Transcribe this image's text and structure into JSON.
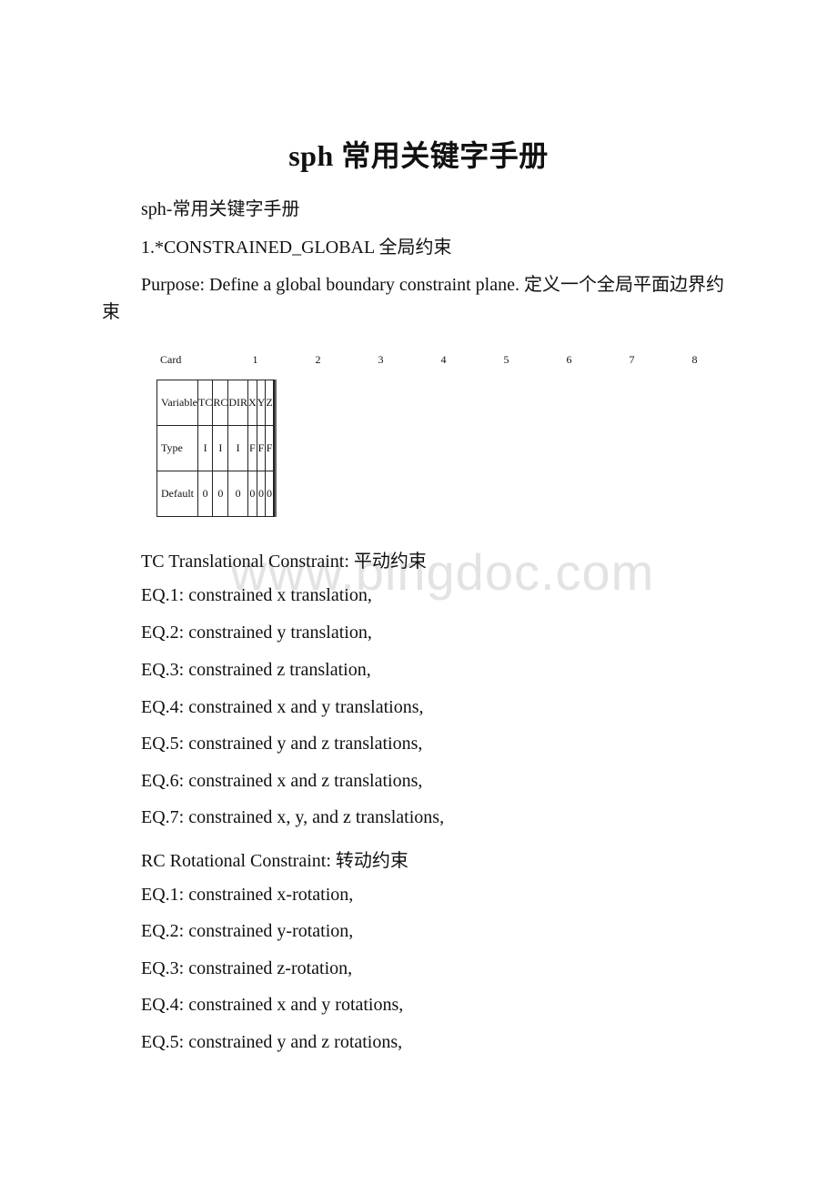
{
  "document": {
    "title": "sph 常用关键字手册",
    "subtitle": "sph-常用关键字手册",
    "section_heading": "1.*CONSTRAINED_GLOBAL 全局约束",
    "purpose": "Purpose: Define a global boundary constraint plane. 定义一个全局平面边界约束",
    "watermark": "www.bingdoc.com"
  },
  "card_table": {
    "header_label": "Card",
    "columns": [
      "1",
      "2",
      "3",
      "4",
      "5",
      "6",
      "7",
      "8"
    ],
    "rows": [
      {
        "label": "Variable",
        "cells": [
          "TC",
          "RC",
          "DIR",
          "X",
          "Y",
          "Z",
          "",
          ""
        ]
      },
      {
        "label": "Type",
        "cells": [
          "I",
          "I",
          "I",
          "F",
          "F",
          "F",
          "",
          ""
        ]
      },
      {
        "label": "Default",
        "cells": [
          "0",
          "0",
          "0",
          "0",
          "0",
          "0",
          "",
          ""
        ]
      }
    ]
  },
  "tc_section": {
    "heading": "TC  Translational Constraint: 平动约束",
    "items": [
      "EQ.1: constrained x translation,",
      "EQ.2: constrained y translation,",
      "EQ.3: constrained z translation,",
      "EQ.4: constrained x and y translations,",
      "EQ.5: constrained y and z translations,",
      "EQ.6: constrained x and z translations,",
      "EQ.7: constrained x, y, and z translations,"
    ]
  },
  "rc_section": {
    "heading": "RC  Rotational Constraint:  转动约束",
    "items": [
      "EQ.1: constrained x-rotation,",
      "EQ.2: constrained y-rotation,",
      "EQ.3: constrained z-rotation,",
      "EQ.4: constrained x and y rotations,",
      "EQ.5: constrained y and z rotations,"
    ]
  }
}
